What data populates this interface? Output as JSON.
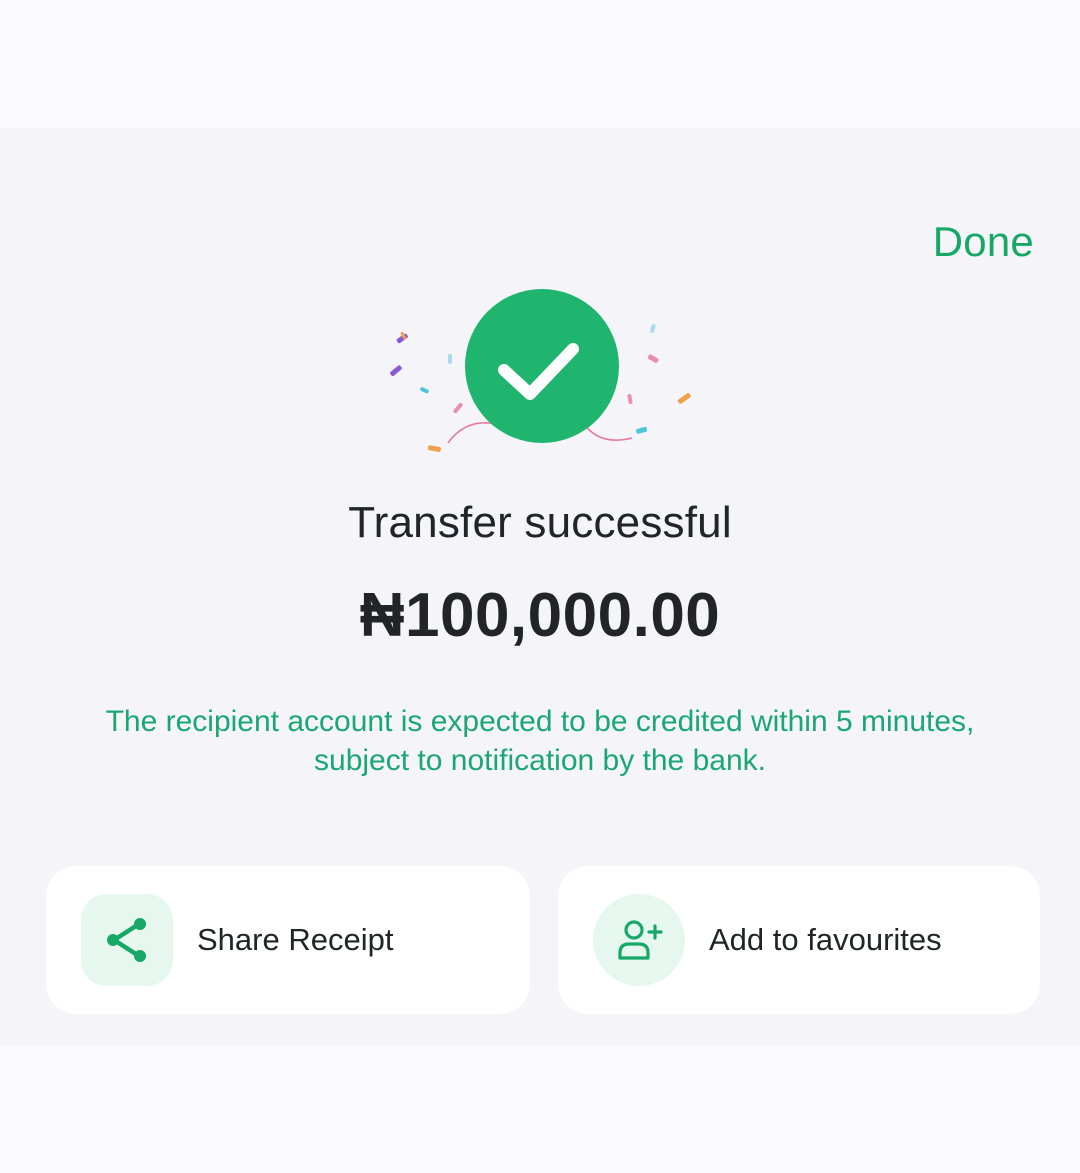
{
  "header": {
    "done_label": "Done"
  },
  "result": {
    "status_icon": "check-circle-icon",
    "title": "Transfer successful",
    "amount": "₦100,000.00",
    "note": "The recipient account is expected to be credited within 5 minutes, subject to notification by the bank."
  },
  "actions": [
    {
      "label": "Share Receipt",
      "icon": "share-icon"
    },
    {
      "label": "Add to favourites",
      "icon": "add-user-icon"
    }
  ],
  "colors": {
    "accent": "#17a868",
    "success_circle": "#20b56e",
    "icon_background": "#e6f7ef",
    "text_primary": "#222428"
  }
}
